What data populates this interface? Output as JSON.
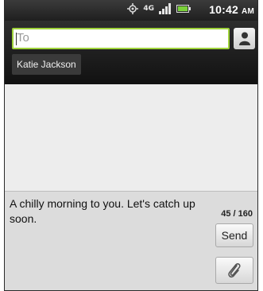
{
  "status_bar": {
    "network_label": "4G",
    "time": "10:42",
    "ampm": "AM",
    "icons": [
      "gps-icon",
      "network-4g-icon",
      "signal-icon",
      "battery-icon"
    ]
  },
  "compose": {
    "to_placeholder": "To",
    "recipient": "Katie Jackson",
    "contact_icon": "contact-person-icon"
  },
  "message": {
    "text": "A chilly morning to you. Let's catch up soon.",
    "char_count": "45 / 160",
    "send_label": "Send",
    "attach_icon": "paperclip-icon"
  },
  "colors": {
    "field_focus": "#9fd23b",
    "header_bg": "#111111",
    "content_bg": "#ededed"
  }
}
